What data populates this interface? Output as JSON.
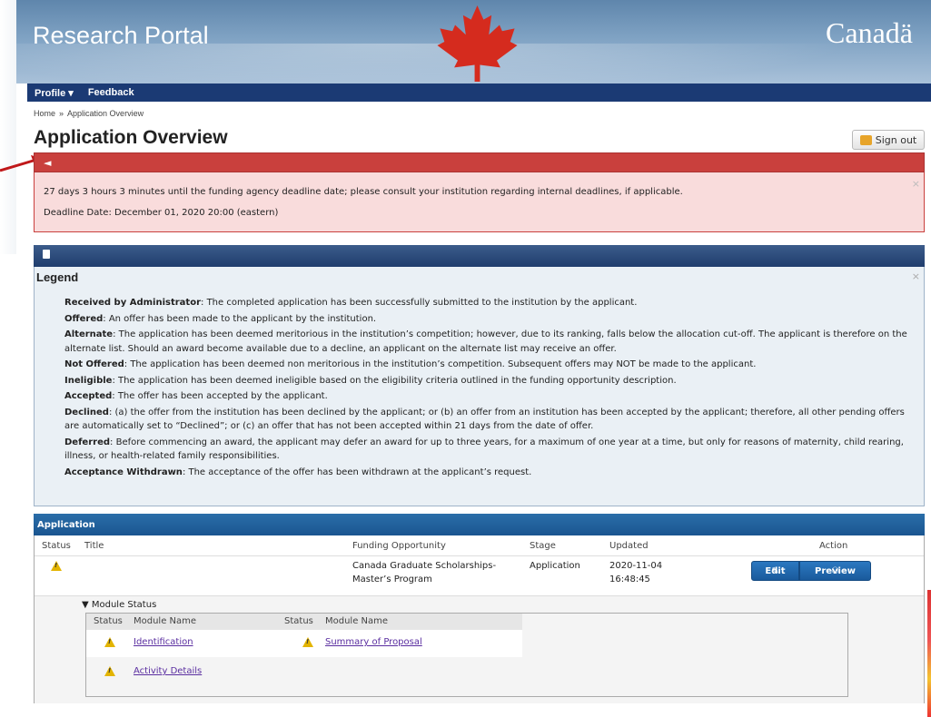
{
  "header": {
    "portal_title": "Research Portal",
    "wordmark": "Canadä"
  },
  "nav": {
    "items": [
      {
        "label": "Profile ▾"
      },
      {
        "label": "Feedback"
      }
    ]
  },
  "breadcrumb": {
    "home": "Home",
    "separator": "»",
    "current": "Application Overview"
  },
  "page": {
    "title": "Application Overview",
    "sign_out_label": "Sign out"
  },
  "alert": {
    "line1": "27 days 3 hours 3 minutes until the funding agency deadline date; please consult your institution regarding internal deadlines, if applicable.",
    "line2": "Deadline Date: December 01, 2020 20:00 (eastern)",
    "close": "×"
  },
  "legend": {
    "title": "Legend",
    "close": "×",
    "items": [
      {
        "term": "Received by Administrator",
        "desc": ": The completed application has been successfully submitted to the institution by the applicant."
      },
      {
        "term": "Offered",
        "desc": ": An offer has been made to the applicant by the institution."
      },
      {
        "term": "Alternate",
        "desc": ": The application has been deemed meritorious in the institution’s competition; however, due to its ranking, falls below the allocation cut-off. The applicant is therefore on the alternate list. Should an award become available due to a decline, an applicant on the alternate list may receive an offer."
      },
      {
        "term": "Not Offered",
        "desc": ": The application has been deemed non meritorious in the institution’s competition. Subsequent offers may NOT be made to the applicant."
      },
      {
        "term": "Ineligible",
        "desc": ": The application has been deemed ineligible based on the eligibility criteria outlined in the funding opportunity description."
      },
      {
        "term": "Accepted",
        "desc": ": The offer has been accepted by the applicant."
      },
      {
        "term": "Declined",
        "desc": ": (a) the offer from the institution has been declined by the applicant; or (b) an offer from an institution has been accepted by the applicant; therefore, all other pending offers are automatically set to “Declined”; or (c) an offer that has not been accepted within 21 days from the date of offer."
      },
      {
        "term": "Deferred",
        "desc": ": Before commencing an award, the applicant may defer an award for up to three years, for a maximum of one year at a time, but only for reasons of maternity, child rearing, illness, or health-related family responsibilities."
      },
      {
        "term": "Acceptance Withdrawn",
        "desc": ": The acceptance of the offer has been withdrawn at the applicant’s request."
      }
    ]
  },
  "application": {
    "section_title": "Application",
    "columns": {
      "status": "Status",
      "title": "Title",
      "funding": "Funding Opportunity",
      "stage": "Stage",
      "updated": "Updated",
      "action": "Action"
    },
    "row": {
      "status_icon": "warning-icon",
      "title": "",
      "funding_line1": "Canada Graduate Scholarships-",
      "funding_line2": "Master’s Program",
      "stage": "Application",
      "updated_date": "2020-11-04",
      "updated_time": "16:48:45",
      "edit_label": "Edit",
      "preview_label": "Preview"
    },
    "modules": {
      "toggle_label": "▼ Module Status",
      "columns": {
        "status": "Status",
        "name": "Module Name"
      },
      "items": [
        {
          "name": "Identification",
          "status_icon": "warning-icon"
        },
        {
          "name": "Summary of Proposal",
          "status_icon": "warning-icon"
        },
        {
          "name": "Activity Details",
          "status_icon": "warning-icon"
        }
      ]
    }
  }
}
